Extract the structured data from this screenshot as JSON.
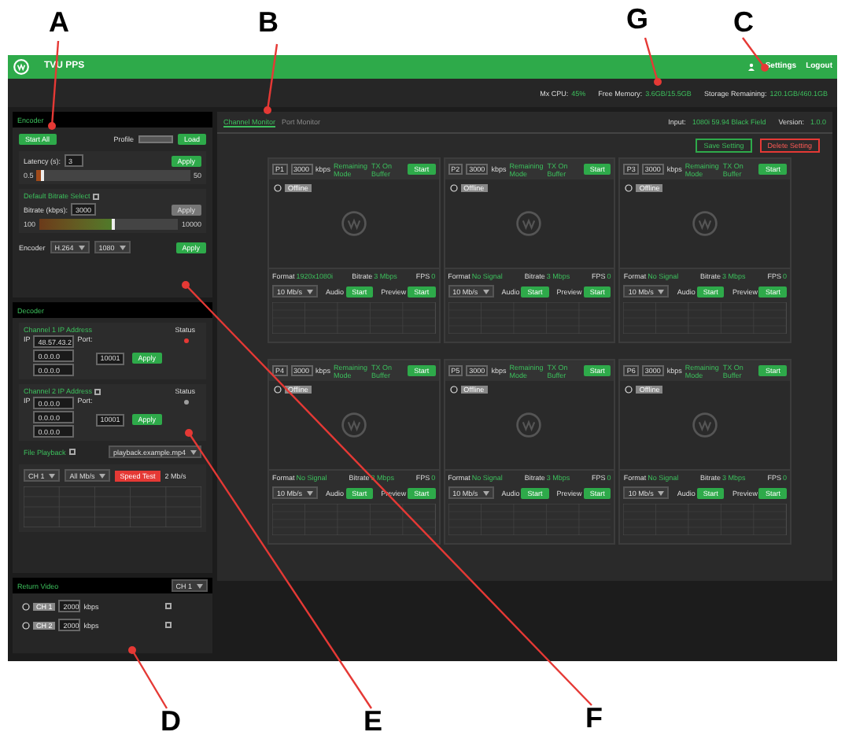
{
  "annotations": [
    {
      "letter": "A"
    },
    {
      "letter": "B"
    },
    {
      "letter": "G"
    },
    {
      "letter": "C"
    },
    {
      "letter": "D"
    },
    {
      "letter": "E"
    },
    {
      "letter": "F"
    }
  ],
  "header": {
    "title": "TVU PPS",
    "links": [
      "Settings",
      "Logout"
    ]
  },
  "stats": [
    {
      "label": "Mx CPU:",
      "value": "45%"
    },
    {
      "label": "Free Memory:",
      "value": "3.6GB/15.5GB"
    },
    {
      "label": "Storage Remaining:",
      "value": "120.1GB/460.1GB"
    }
  ],
  "encoder": {
    "title": "Encoder",
    "start_all": "Start All",
    "profile_label": "Profile",
    "load": "Load",
    "latency_label": "Latency (s):",
    "latency_value": "3",
    "latency_apply": "Apply",
    "latency_slider": {
      "level": 0.03,
      "min": "0.5",
      "max": "50"
    },
    "default_bitrate": {
      "label": "Default Bitrate Select",
      "checked": false
    },
    "bitrate_label": "Bitrate (kbps):",
    "bitrate_value": "3000",
    "bitrate_apply": {
      "label": "Apply",
      "disabled": true
    },
    "bitrate_slider": {
      "level": 0.52,
      "min": "100",
      "max": "10000"
    },
    "encoder_label": "Encoder",
    "encoder_select": "H.264",
    "resolution_select": "1080",
    "apply": "Apply"
  },
  "decoder": {
    "title": "Decoder",
    "channels": [
      {
        "label": "Channel 1 IP Address",
        "kind": "plain",
        "status_label": "Status",
        "color": "#e53935",
        "ip_label": "IP",
        "ips": [
          "48.57.43.2",
          "0.0.0.0",
          "0.0.0.0"
        ],
        "port_label": "Port:",
        "port": "10001",
        "apply": "Apply"
      },
      {
        "label": "Channel 2 IP Address",
        "kind": "checkable",
        "checked": false,
        "status_label": "Status",
        "color": "#9e9e9e",
        "ip_label": "IP",
        "ips": [
          "0.0.0.0",
          "0.0.0.0",
          "0.0.0.0"
        ],
        "port_label": "Port:",
        "port": "10001",
        "apply": "Apply"
      }
    ],
    "file_playback": {
      "label": "File Playback",
      "checked": false,
      "select": "playback.example.mp4"
    },
    "speed": {
      "channel": "CH 1",
      "rate": "All Mb/s",
      "button": "Speed Test",
      "result": "2 Mb/s"
    }
  },
  "return_video": {
    "title": "Return Video",
    "select": "CH 1",
    "rows": [
      {
        "name": "CH 1",
        "bitrate": "2000",
        "unit": "kbps",
        "checked": false
      },
      {
        "name": "CH 2",
        "bitrate": "2000",
        "unit": "kbps",
        "checked": false
      }
    ]
  },
  "main": {
    "tabs": [
      {
        "label": "Channel Monitor",
        "selected": true
      },
      {
        "label": "Port Monitor",
        "selected": false
      }
    ],
    "input": {
      "label": "Input:",
      "value": "1080i 59.94 Black Field"
    },
    "version": {
      "label": "Version:",
      "value": "1.0.0"
    },
    "save": "Save Setting",
    "delete": "Delete Setting",
    "channels": [
      {
        "id": "P1",
        "bitrate": "3000",
        "unit": "kbps",
        "mode1": "Remaining Mode",
        "mode2": "TX On Buffer",
        "start": "Start",
        "status": "Offline",
        "format_label": "Format",
        "format": "1920x1080i",
        "bps_label": "Bitrate",
        "bps": "3 Mbps",
        "fps_label": "FPS",
        "fps": "0",
        "rate": "10 Mb/s",
        "audio_label": "Audio",
        "audio_btn": "Start",
        "preview_label": "Preview",
        "preview_btn": "Start"
      },
      {
        "id": "P2",
        "bitrate": "3000",
        "unit": "kbps",
        "mode1": "Remaining Mode",
        "mode2": "TX On Buffer",
        "start": "Start",
        "status": "Offline",
        "format_label": "Format",
        "format": "No Signal",
        "bps_label": "Bitrate",
        "bps": "3 Mbps",
        "fps_label": "FPS",
        "fps": "0",
        "rate": "10 Mb/s",
        "audio_label": "Audio",
        "audio_btn": "Start",
        "preview_label": "Preview",
        "preview_btn": "Start"
      },
      {
        "id": "P3",
        "bitrate": "3000",
        "unit": "kbps",
        "mode1": "Remaining Mode",
        "mode2": "TX On Buffer",
        "start": "Start",
        "status": "Offline",
        "format_label": "Format",
        "format": "No Signal",
        "bps_label": "Bitrate",
        "bps": "3 Mbps",
        "fps_label": "FPS",
        "fps": "0",
        "rate": "10 Mb/s",
        "audio_label": "Audio",
        "audio_btn": "Start",
        "preview_label": "Preview",
        "preview_btn": "Start"
      },
      {
        "id": "P4",
        "bitrate": "3000",
        "unit": "kbps",
        "mode1": "Remaining Mode",
        "mode2": "TX On Buffer",
        "start": "Start",
        "status": "Offline",
        "format_label": "Format",
        "format": "No Signal",
        "bps_label": "Bitrate",
        "bps": "3 Mbps",
        "fps_label": "FPS",
        "fps": "0",
        "rate": "10 Mb/s",
        "audio_label": "Audio",
        "audio_btn": "Start",
        "preview_label": "Preview",
        "preview_btn": "Start"
      },
      {
        "id": "P5",
        "bitrate": "3000",
        "unit": "kbps",
        "mode1": "Remaining Mode",
        "mode2": "TX On Buffer",
        "start": "Start",
        "status": "Offline",
        "format_label": "Format",
        "format": "No Signal",
        "bps_label": "Bitrate",
        "bps": "3 Mbps",
        "fps_label": "FPS",
        "fps": "0",
        "rate": "10 Mb/s",
        "audio_label": "Audio",
        "audio_btn": "Start",
        "preview_label": "Preview",
        "preview_btn": "Start"
      },
      {
        "id": "P6",
        "bitrate": "3000",
        "unit": "kbps",
        "mode1": "Remaining Mode",
        "mode2": "TX On Buffer",
        "start": "Start",
        "status": "Offline",
        "format_label": "Format",
        "format": "No Signal",
        "bps_label": "Bitrate",
        "bps": "3 Mbps",
        "fps_label": "FPS",
        "fps": "0",
        "rate": "10 Mb/s",
        "audio_label": "Audio",
        "audio_btn": "Start",
        "preview_label": "Preview",
        "preview_btn": "Start"
      }
    ]
  }
}
